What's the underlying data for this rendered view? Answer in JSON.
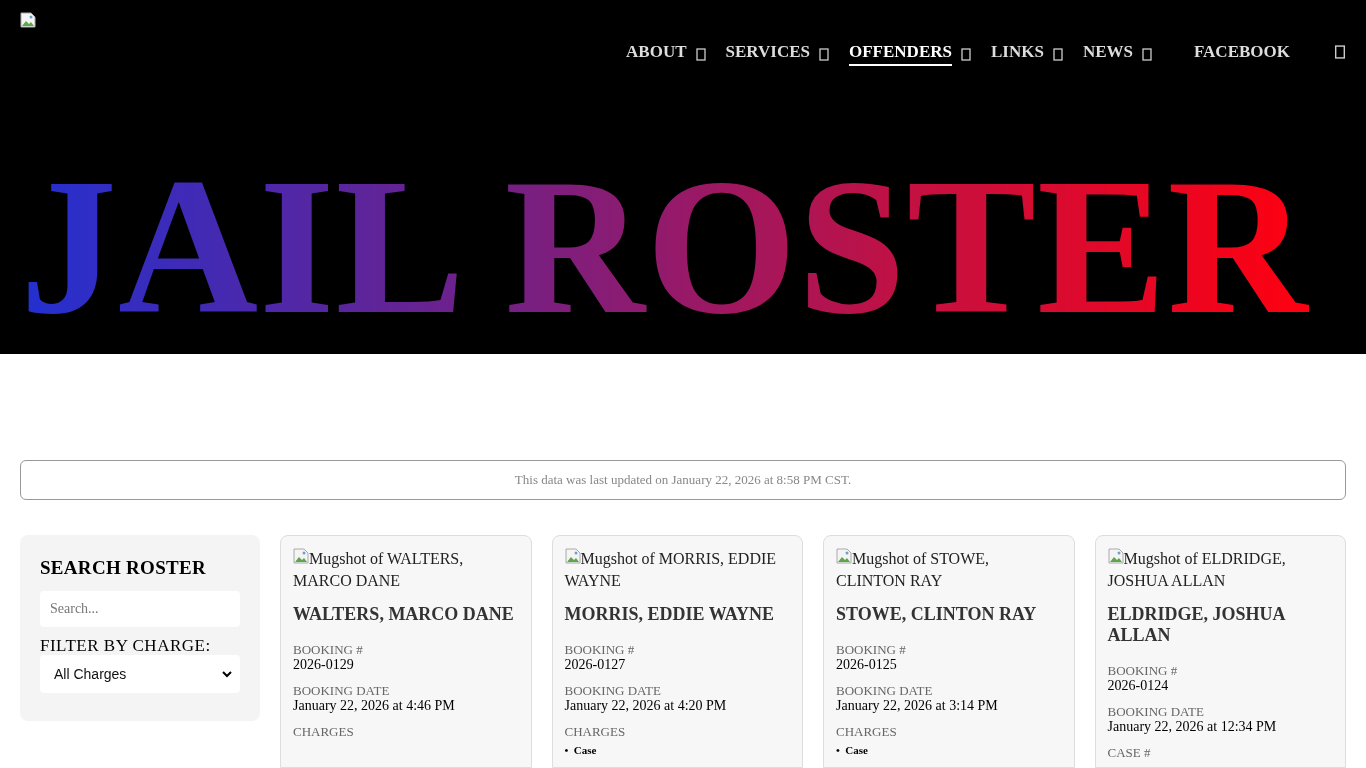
{
  "header": {
    "nav": [
      {
        "label": "ABOUT",
        "selected": false,
        "dropdown": true
      },
      {
        "label": "SERVICES",
        "selected": false,
        "dropdown": true
      },
      {
        "label": "OFFENDERS",
        "selected": true,
        "dropdown": true
      },
      {
        "label": "LINKS",
        "selected": false,
        "dropdown": true
      },
      {
        "label": "NEWS",
        "selected": false,
        "dropdown": true
      },
      {
        "label": "FACEBOOK",
        "selected": false,
        "dropdown": false
      }
    ],
    "title": "JAIL ROSTER"
  },
  "update_notice": "This data was last updated on January 22, 2026 at 8:58 PM CST.",
  "sidebar": {
    "heading": "SEARCH ROSTER",
    "search": {
      "placeholder": "Search..."
    },
    "filter_label": "FILTER BY CHARGE:",
    "filter_value": "All Charges"
  },
  "cards": [
    {
      "image_alt": "Mugshot of WALTERS, MARCO DANE",
      "name": "WALTERS, MARCO DANE",
      "fields": [
        {
          "label": "BOOKING #",
          "value": "2026-0129"
        },
        {
          "label": "BOOKING DATE",
          "value": "January 22, 2026 at 4:46 PM"
        },
        {
          "label": "CHARGES"
        }
      ]
    },
    {
      "image_alt": "Mugshot of MORRIS, EDDIE WAYNE",
      "name": "MORRIS, EDDIE WAYNE",
      "fields": [
        {
          "label": "BOOKING #",
          "value": "2026-0127"
        },
        {
          "label": "BOOKING DATE",
          "value": "January 22, 2026 at 4:20 PM"
        },
        {
          "label": "CHARGES"
        }
      ],
      "charges": [
        {
          "marker": "•",
          "text": "Case"
        }
      ]
    },
    {
      "image_alt": "Mugshot of STOWE, CLINTON RAY",
      "name": "STOWE, CLINTON RAY",
      "fields": [
        {
          "label": "BOOKING #",
          "value": "2026-0125"
        },
        {
          "label": "BOOKING DATE",
          "value": "January 22, 2026 at 3:14 PM"
        },
        {
          "label": "CHARGES"
        }
      ],
      "charges": [
        {
          "marker": "•",
          "text": "Case"
        }
      ]
    },
    {
      "image_alt": "Mugshot of ELDRIDGE, JOSHUA ALLAN",
      "name": "ELDRIDGE, JOSHUA ALLAN",
      "fields": [
        {
          "label": "BOOKING #",
          "value": "2026-0124"
        },
        {
          "label": "BOOKING DATE",
          "value": "January 22, 2026 at 12:34 PM"
        },
        {
          "label": "CASE #"
        }
      ]
    }
  ]
}
